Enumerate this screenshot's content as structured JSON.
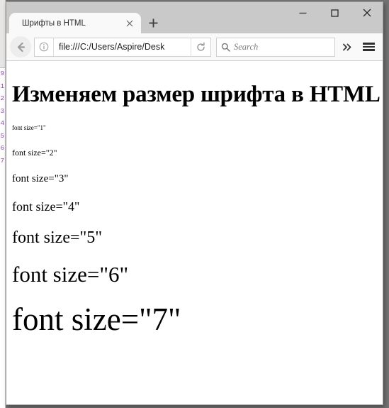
{
  "window": {
    "controls": {
      "minimize_label": "Minimize",
      "maximize_label": "Maximize",
      "close_label": "Close"
    }
  },
  "tabstrip": {
    "active_tab_title": "Шрифты в HTML",
    "close_tab_label": "×",
    "new_tab_label": "+"
  },
  "navbar": {
    "back_label": "Back",
    "identity_label": "Site information",
    "url_value": "file:///C:/Users/Aspire/Desk",
    "reload_label": "Reload",
    "search_placeholder": "Search",
    "search_value": "",
    "overflow_label": "»",
    "menu_label": "Open menu"
  },
  "page": {
    "heading": "Изменяем размер шрифта в HTML",
    "lines": [
      {
        "text": "font size=\"1\"",
        "size": "1"
      },
      {
        "text": "font size=\"2\"",
        "size": "2"
      },
      {
        "text": "font size=\"3\"",
        "size": "3"
      },
      {
        "text": "font size=\"4\"",
        "size": "4"
      },
      {
        "text": "font size=\"5\"",
        "size": "5"
      },
      {
        "text": "font size=\"6\"",
        "size": "6"
      },
      {
        "text": "font size=\"7\"",
        "size": "7"
      }
    ]
  },
  "editor_sliver": {
    "line_numbers": [
      "9",
      "1",
      "2",
      "3",
      "4",
      "5",
      "6",
      "7"
    ],
    "gutter_color": "#8f3fbf"
  },
  "colors": {
    "desktop": "#737373",
    "titlebar": "#c9c9c9",
    "toolbar": "#f9f9f9",
    "content_bg": "#ffffff",
    "text": "#000000"
  }
}
